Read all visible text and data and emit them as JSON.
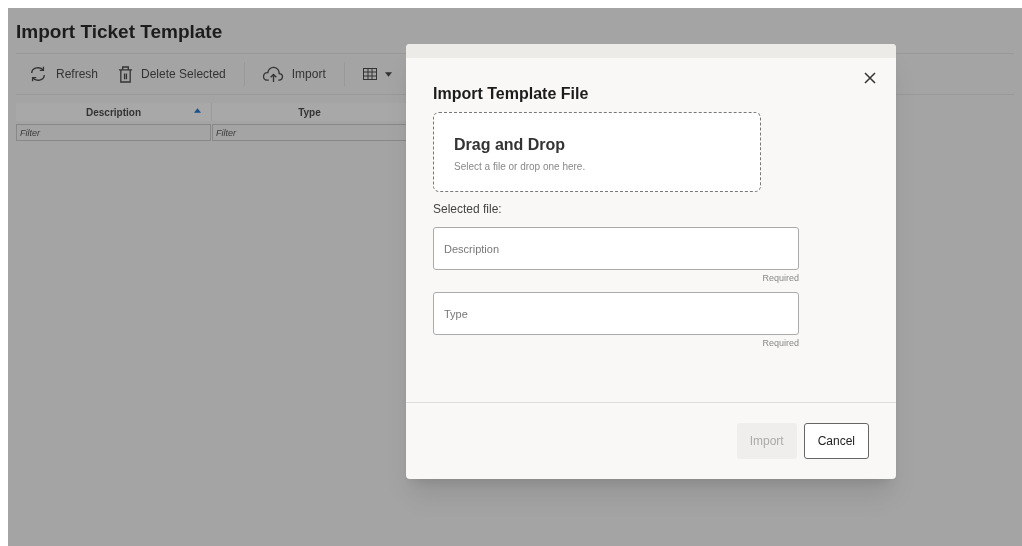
{
  "page": {
    "title": "Import Ticket Template"
  },
  "toolbar": [
    {
      "kind": "refresh",
      "label": "Refresh"
    },
    {
      "kind": "delete",
      "label": "Delete Selected"
    },
    {
      "kind": "import",
      "label": "Import"
    },
    {
      "kind": "columns"
    }
  ],
  "table": {
    "columns": [
      {
        "label": "Description",
        "sorted": true,
        "filter_placeholder": "Filter"
      },
      {
        "label": "Type",
        "sorted": false,
        "filter_placeholder": "Filter"
      }
    ]
  },
  "dialog": {
    "title": "Import Template File",
    "dropzone": {
      "title": "Drag and Drop",
      "hint": "Select a file or drop one here."
    },
    "selected_file_label": "Selected file:",
    "fields": [
      {
        "placeholder": "Description",
        "helper": "Required"
      },
      {
        "placeholder": "Type",
        "helper": "Required"
      }
    ],
    "buttons": [
      {
        "label": "Import",
        "disabled": true
      },
      {
        "label": "Cancel",
        "disabled": false
      }
    ]
  }
}
